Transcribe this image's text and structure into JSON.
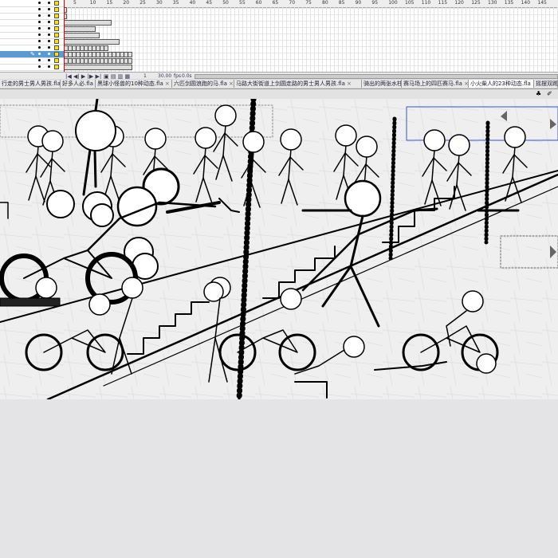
{
  "timeline": {
    "ruler_labels": [
      "5",
      "10",
      "15",
      "20",
      "25",
      "30",
      "35",
      "40",
      "45",
      "50",
      "55",
      "60",
      "65",
      "70",
      "75",
      "80",
      "85",
      "90",
      "95",
      "100",
      "105",
      "110",
      "115",
      "120",
      "125",
      "130",
      "135",
      "140",
      "145"
    ],
    "current_frame": "1",
    "fps": "30.00",
    "fps_unit": "fps",
    "elapsed": "0.0s"
  },
  "tabs": [
    {
      "label": "行走的男士男人男孩.fla"
    },
    {
      "label": "好多人必.fla"
    },
    {
      "label": "黑球小怪兽的10种动态.fla"
    },
    {
      "label": "六匹剑圆浪跑的马.fla"
    },
    {
      "label": "马路大街街道上剑圆走路的男士男人男孩.fla"
    },
    {
      "label": "骑出的两张水柱.fla"
    },
    {
      "label": "赛马场上的四匹赛马.fla"
    },
    {
      "label": "小火柴人的23种动态.fla"
    },
    {
      "label": "摇摆双踢"
    }
  ],
  "active_tab_index": 7,
  "colors": {
    "layer_selected": "#5a9bd4",
    "keyframe_yellow": "#ffe000",
    "playhead": "#dd0000",
    "guide_blue": "#3355cc"
  }
}
